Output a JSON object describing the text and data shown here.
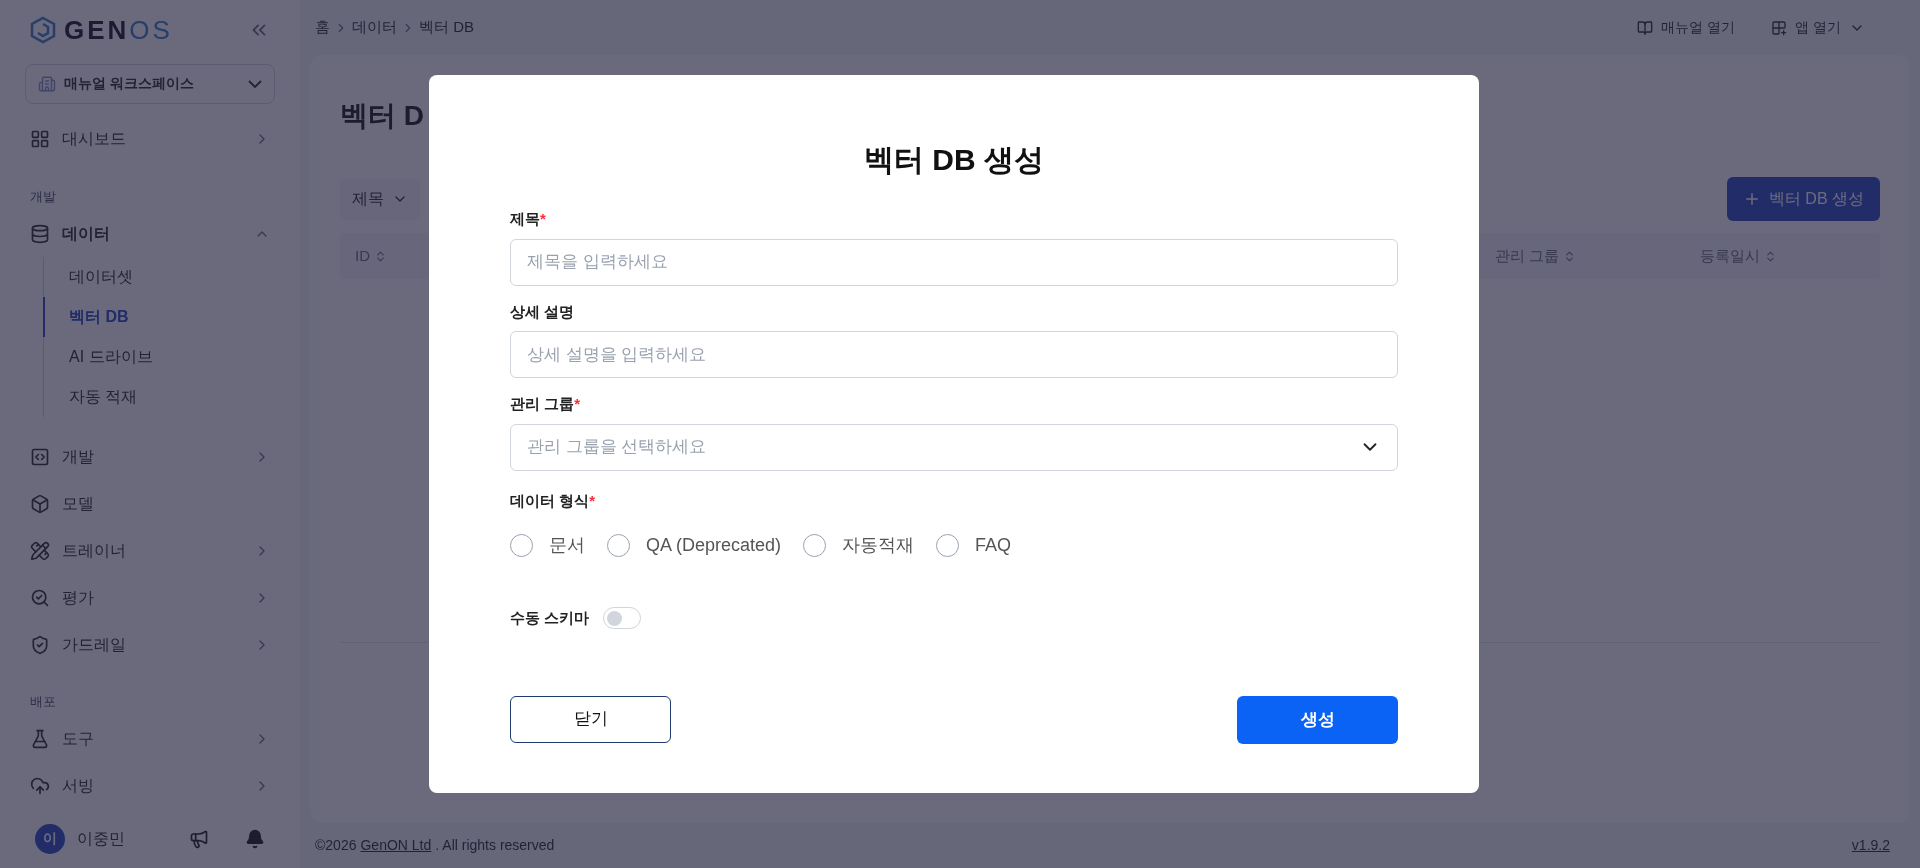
{
  "sidebar": {
    "logo": {
      "part1": "GEN",
      "part2": "OS"
    },
    "workspace": "매뉴얼 워크스페이스",
    "items": [
      {
        "kind": "item",
        "label": "대시보드",
        "chevron": true
      },
      {
        "kind": "section",
        "label": "개발"
      },
      {
        "kind": "item",
        "label": "데이터",
        "expanded": true,
        "children": [
          {
            "label": "데이터셋",
            "selected": false
          },
          {
            "label": "벡터 DB",
            "selected": true
          },
          {
            "label": "AI 드라이브",
            "selected": false
          },
          {
            "label": "자동 적재",
            "selected": false
          }
        ]
      },
      {
        "kind": "item",
        "label": "개발",
        "chevron": true
      },
      {
        "kind": "item",
        "label": "모델",
        "chevron": false
      },
      {
        "kind": "item",
        "label": "트레이너",
        "chevron": true
      },
      {
        "kind": "item",
        "label": "평가",
        "chevron": true
      },
      {
        "kind": "item",
        "label": "가드레일",
        "chevron": true
      },
      {
        "kind": "section",
        "label": "배포"
      },
      {
        "kind": "item",
        "label": "도구",
        "chevron": true
      },
      {
        "kind": "item",
        "label": "서빙",
        "chevron": true
      }
    ],
    "user": {
      "initial": "이",
      "name": "이중민"
    }
  },
  "topbar": {
    "breadcrumb": [
      "홈",
      "데이터",
      "벡터 DB"
    ],
    "manual": "매뉴얼 열기",
    "apps": "앱 열기"
  },
  "page": {
    "title": "벡터 D",
    "filter": "제목",
    "create_button": "벡터 DB 생성",
    "columns": [
      "ID",
      "관리 그룹",
      "등록일시"
    ]
  },
  "footer": {
    "copyright": "©2026",
    "company": "GenON Ltd",
    "rights": ". All rights reserved",
    "version": "v1.9.2"
  },
  "modal": {
    "title": "벡터 DB 생성",
    "fields": [
      {
        "kind": "text",
        "label": "제목",
        "required_mark": "*",
        "placeholder": "제목을 입력하세요"
      },
      {
        "kind": "text",
        "label": "상세 설명",
        "placeholder": "상세 설명을 입력하세요"
      },
      {
        "kind": "select",
        "label": "관리 그룹",
        "required_mark": "*",
        "placeholder": "관리 그룹을 선택하세요"
      }
    ],
    "format": {
      "label": "데이터 형식",
      "required_mark": "*",
      "options": [
        {
          "label": "문서",
          "selected": false
        },
        {
          "label": "QA (Deprecated)",
          "selected": false
        },
        {
          "label": "자동적재",
          "selected": false
        },
        {
          "label": "FAQ",
          "selected": false
        }
      ]
    },
    "manual_schema": {
      "label": "수동 스키마",
      "on": false
    },
    "buttons": {
      "close": "닫기",
      "create": "생성"
    }
  }
}
